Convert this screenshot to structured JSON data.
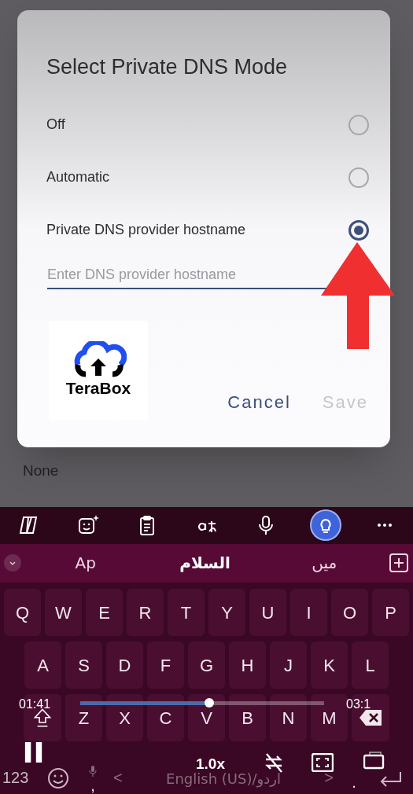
{
  "dialog": {
    "title": "Select Private DNS Mode",
    "options": [
      {
        "label": "Off",
        "selected": false
      },
      {
        "label": "Automatic",
        "selected": false
      },
      {
        "label": "Private DNS provider hostname",
        "selected": true
      }
    ],
    "hostname_field": {
      "placeholder": "Enter DNS provider hostname"
    },
    "logo": {
      "text": "TeraBox"
    },
    "buttons": [
      {
        "label": "Cancel",
        "disabled": false
      },
      {
        "label": "Save",
        "disabled": true
      }
    ]
  },
  "background": {
    "text": "None"
  },
  "keyboard": {
    "toolbar": [
      {
        "kind": "copilot",
        "selected": false
      },
      {
        "kind": "sticker",
        "selected": false
      },
      {
        "kind": "clipboard",
        "selected": false
      },
      {
        "kind": "translate",
        "selected": false
      },
      {
        "kind": "mic",
        "selected": false
      },
      {
        "kind": "ideas",
        "selected": true
      },
      {
        "kind": "more",
        "selected": false
      }
    ],
    "suggestions": {
      "left": {
        "text": "Ap",
        "emphasized": false
      },
      "center": {
        "text": "السلام",
        "emphasized": true
      },
      "right": {
        "text": "میں",
        "emphasized": false
      }
    },
    "rows": [
      [
        "Q",
        "W",
        "E",
        "R",
        "T",
        "Y",
        "U",
        "I",
        "O",
        "P"
      ],
      [
        "A",
        "S",
        "D",
        "F",
        "G",
        "H",
        "J",
        "K",
        "L"
      ],
      [
        "Z",
        "X",
        "C",
        "V",
        "B",
        "N",
        "M"
      ]
    ],
    "bottom": {
      "numbers": "123",
      "comma": ",",
      "prev": "<",
      "language": "English (US)/اردو",
      "next": ">",
      "period": "."
    }
  },
  "video_player": {
    "elapsed": "01:41",
    "duration": "03:1",
    "level": 0.53,
    "speed": "1.0x"
  }
}
